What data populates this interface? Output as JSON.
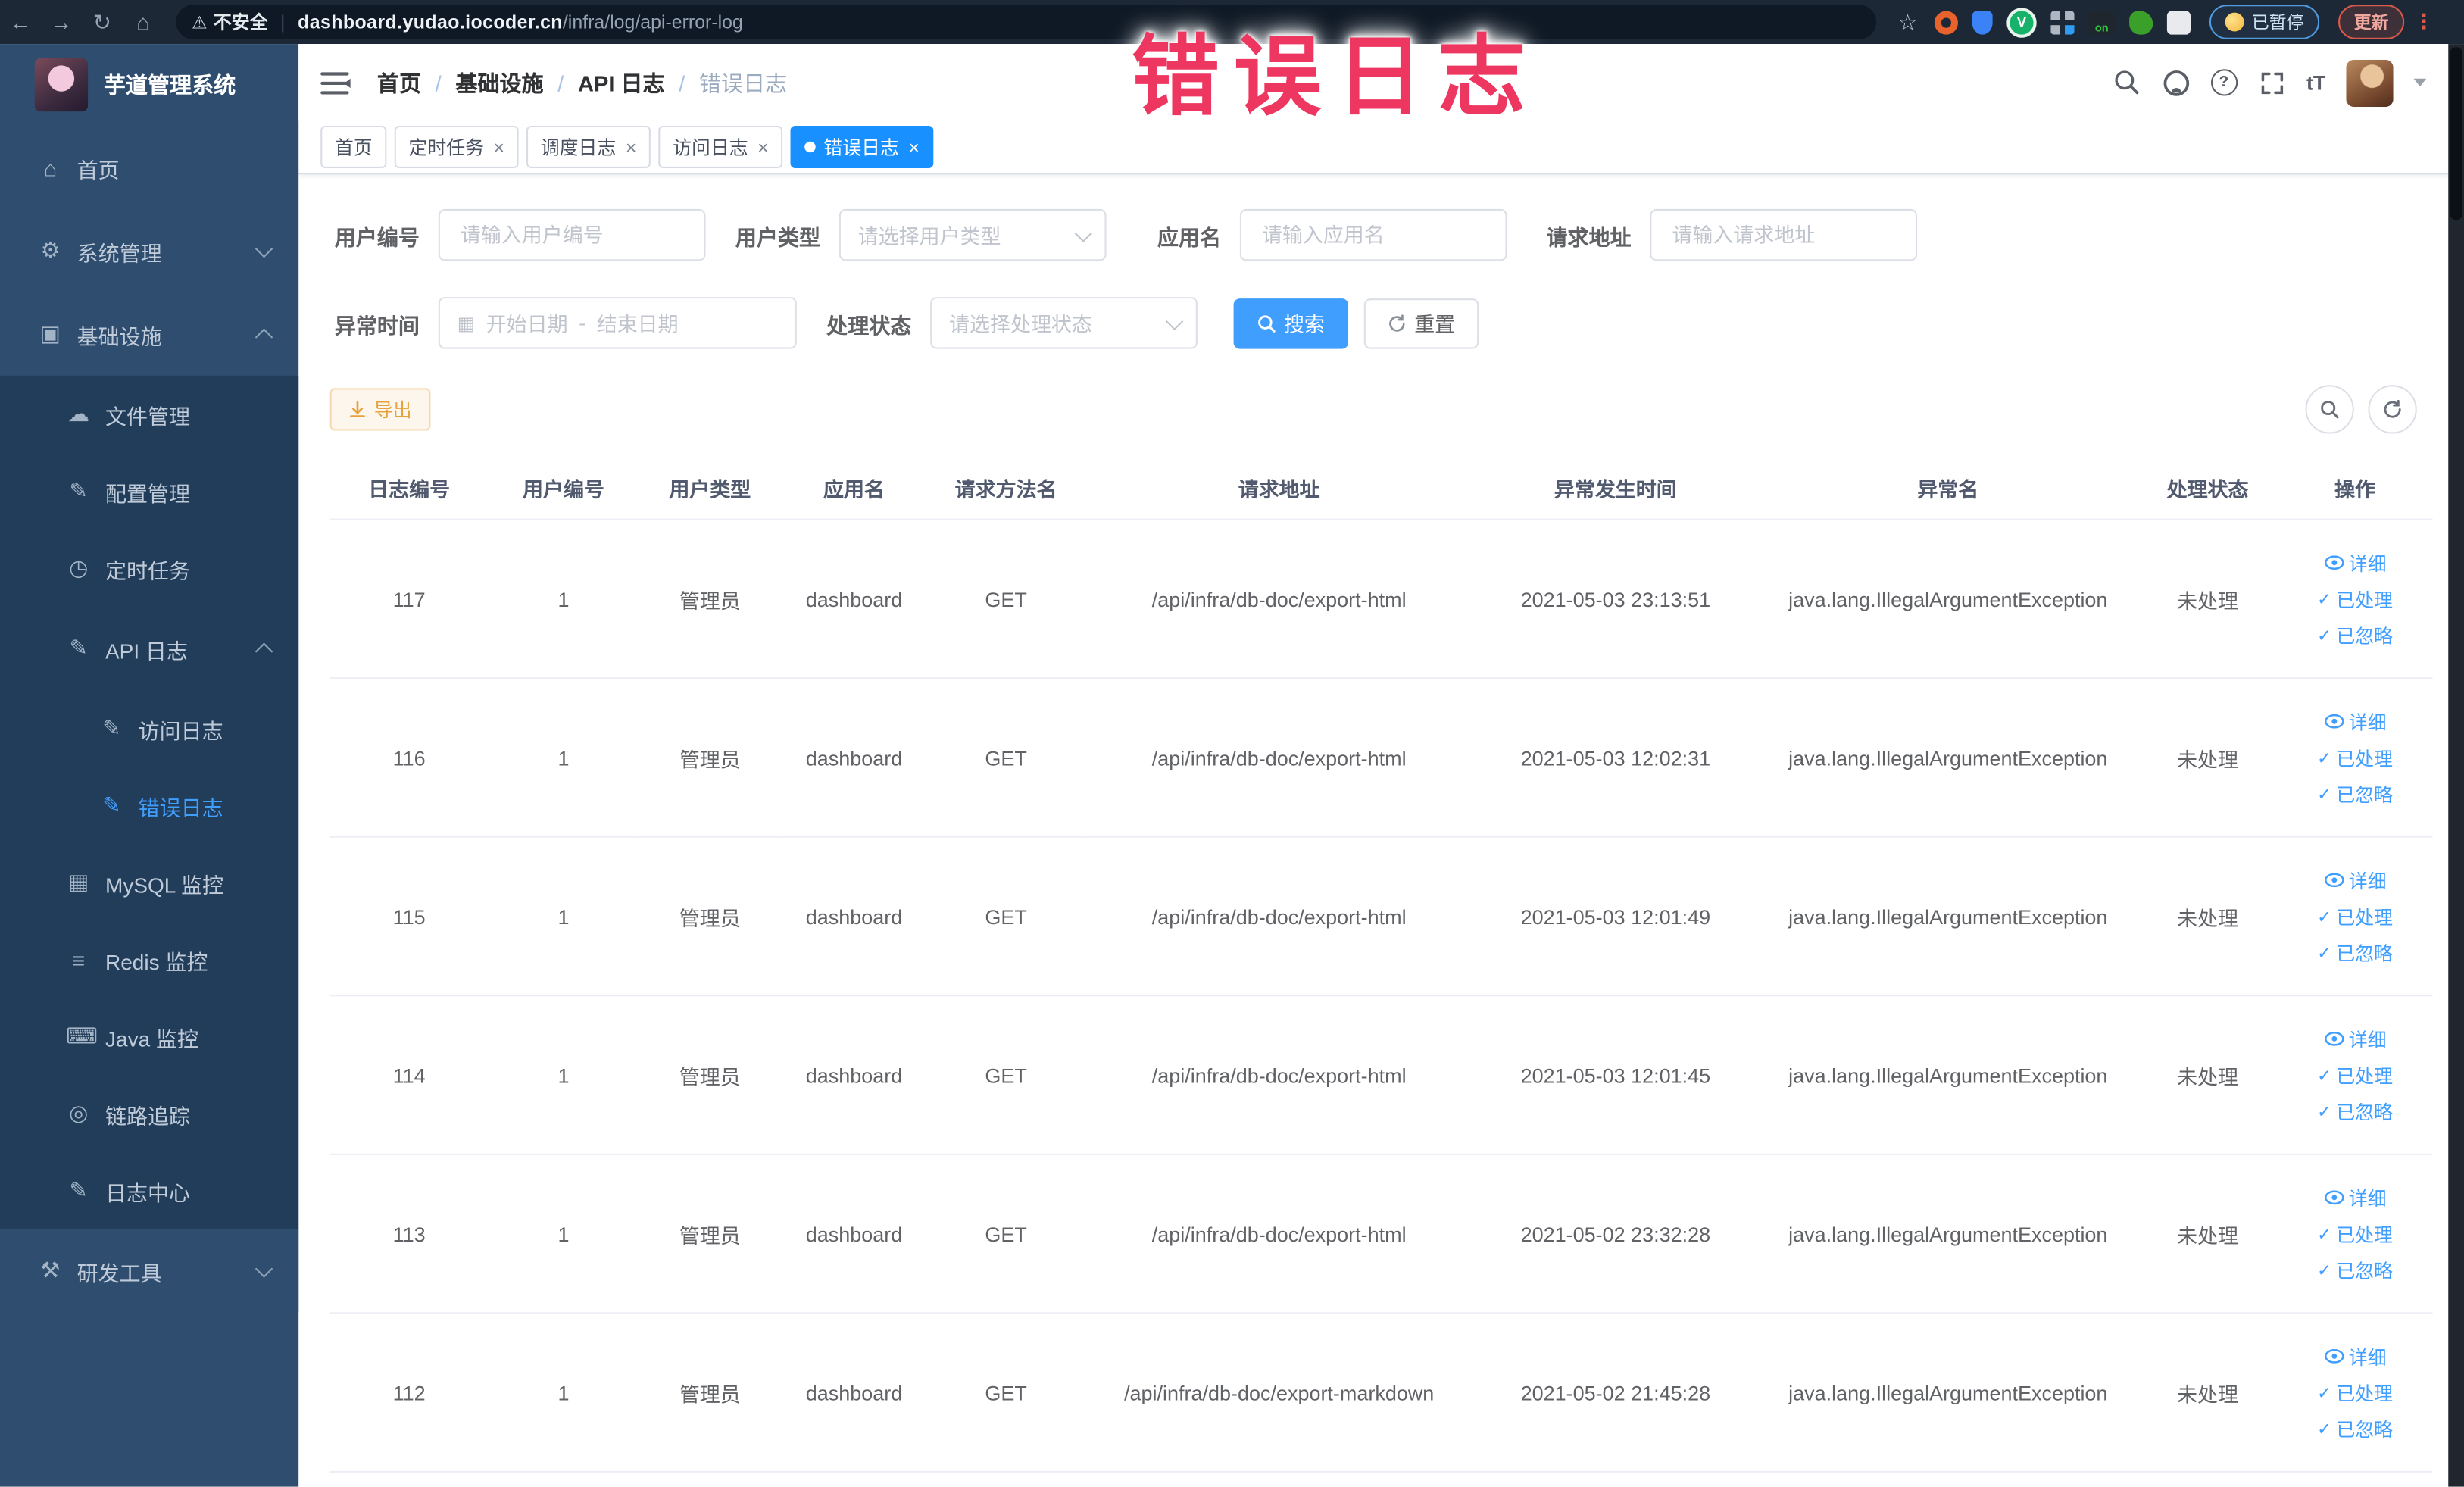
{
  "browser": {
    "security_label": "不安全",
    "url_domain": "dashboard.yudao.iocoder.cn",
    "url_path": "/infra/log/api-error-log",
    "paused_badge": "已暂停",
    "update_badge": "更新"
  },
  "overlay": {
    "text": "错误日志",
    "color": "#ee3760"
  },
  "icons": {
    "back": "←",
    "forward": "→",
    "reload": "↻",
    "home": "⌂",
    "warning": "⚠",
    "star": "☆",
    "kebab": "⋮",
    "close": "×",
    "check": "✓",
    "question": "?",
    "fontsize": "tT",
    "calendar": "▦",
    "breadcrumb_sep": "/",
    "date_sep": "-",
    "ext_v": "V",
    "ext_on": "on",
    "sidebar_home": "⌂",
    "sidebar_system": "⚙",
    "sidebar_infra": "▣",
    "sidebar_file": "☁",
    "sidebar_config": "✎",
    "sidebar_job": "◷",
    "sidebar_apilog": "✎",
    "sidebar_accesslog": "✎",
    "sidebar_errorlog": "✎",
    "sidebar_mysql": "▦",
    "sidebar_redis": "≡",
    "sidebar_java": "⌨",
    "sidebar_trace": "◎",
    "sidebar_logcenter": "✎",
    "sidebar_devtools": "⚒"
  },
  "sidebar": {
    "title": "芋道管理系统",
    "home": "首页",
    "system": "系统管理",
    "infra": "基础设施",
    "file": "文件管理",
    "config": "配置管理",
    "job": "定时任务",
    "api_log": "API 日志",
    "access_log": "访问日志",
    "error_log": "错误日志",
    "mysql": "MySQL 监控",
    "redis": "Redis 监控",
    "java": "Java 监控",
    "trace": "链路追踪",
    "log_center": "日志中心",
    "dev_tools": "研发工具"
  },
  "header": {
    "breadcrumb": [
      "首页",
      "基础设施",
      "API 日志",
      "错误日志"
    ]
  },
  "tabs": [
    {
      "label": "首页",
      "closable": false,
      "active": false
    },
    {
      "label": "定时任务",
      "closable": true,
      "active": false
    },
    {
      "label": "调度日志",
      "closable": true,
      "active": false
    },
    {
      "label": "访问日志",
      "closable": true,
      "active": false
    },
    {
      "label": "错误日志",
      "closable": true,
      "active": true
    }
  ],
  "filters": {
    "user_id": {
      "label": "用户编号",
      "placeholder": "请输入用户编号",
      "value": ""
    },
    "user_type": {
      "label": "用户类型",
      "placeholder": "请选择用户类型"
    },
    "app_name": {
      "label": "应用名",
      "placeholder": "请输入应用名",
      "value": ""
    },
    "request_url": {
      "label": "请求地址",
      "placeholder": "请输入请求地址",
      "value": ""
    },
    "exception_time": {
      "label": "异常时间",
      "start_placeholder": "开始日期",
      "end_placeholder": "结束日期"
    },
    "process_status": {
      "label": "处理状态",
      "placeholder": "请选择处理状态"
    },
    "search_label": "搜索",
    "reset_label": "重置"
  },
  "toolbar": {
    "export_label": "导出"
  },
  "table": {
    "columns": [
      "日志编号",
      "用户编号",
      "用户类型",
      "应用名",
      "请求方法名",
      "请求地址",
      "异常发生时间",
      "异常名",
      "处理状态",
      "操作"
    ],
    "actions": [
      "详细",
      "已处理",
      "已忽略"
    ],
    "rows": [
      {
        "id": "117",
        "user_id": "1",
        "user_type": "管理员",
        "app": "dashboard",
        "method": "GET",
        "url": "/api/infra/db-doc/export-html",
        "time": "2021-05-03 23:13:51",
        "exception": "java.lang.IllegalArgumentException",
        "status": "未处理"
      },
      {
        "id": "116",
        "user_id": "1",
        "user_type": "管理员",
        "app": "dashboard",
        "method": "GET",
        "url": "/api/infra/db-doc/export-html",
        "time": "2021-05-03 12:02:31",
        "exception": "java.lang.IllegalArgumentException",
        "status": "未处理"
      },
      {
        "id": "115",
        "user_id": "1",
        "user_type": "管理员",
        "app": "dashboard",
        "method": "GET",
        "url": "/api/infra/db-doc/export-html",
        "time": "2021-05-03 12:01:49",
        "exception": "java.lang.IllegalArgumentException",
        "status": "未处理"
      },
      {
        "id": "114",
        "user_id": "1",
        "user_type": "管理员",
        "app": "dashboard",
        "method": "GET",
        "url": "/api/infra/db-doc/export-html",
        "time": "2021-05-03 12:01:45",
        "exception": "java.lang.IllegalArgumentException",
        "status": "未处理"
      },
      {
        "id": "113",
        "user_id": "1",
        "user_type": "管理员",
        "app": "dashboard",
        "method": "GET",
        "url": "/api/infra/db-doc/export-html",
        "time": "2021-05-02 23:32:28",
        "exception": "java.lang.IllegalArgumentException",
        "status": "未处理"
      },
      {
        "id": "112",
        "user_id": "1",
        "user_type": "管理员",
        "app": "dashboard",
        "method": "GET",
        "url": "/api/infra/db-doc/export-markdown",
        "time": "2021-05-02 21:45:28",
        "exception": "java.lang.IllegalArgumentException",
        "status": "未处理"
      }
    ]
  }
}
